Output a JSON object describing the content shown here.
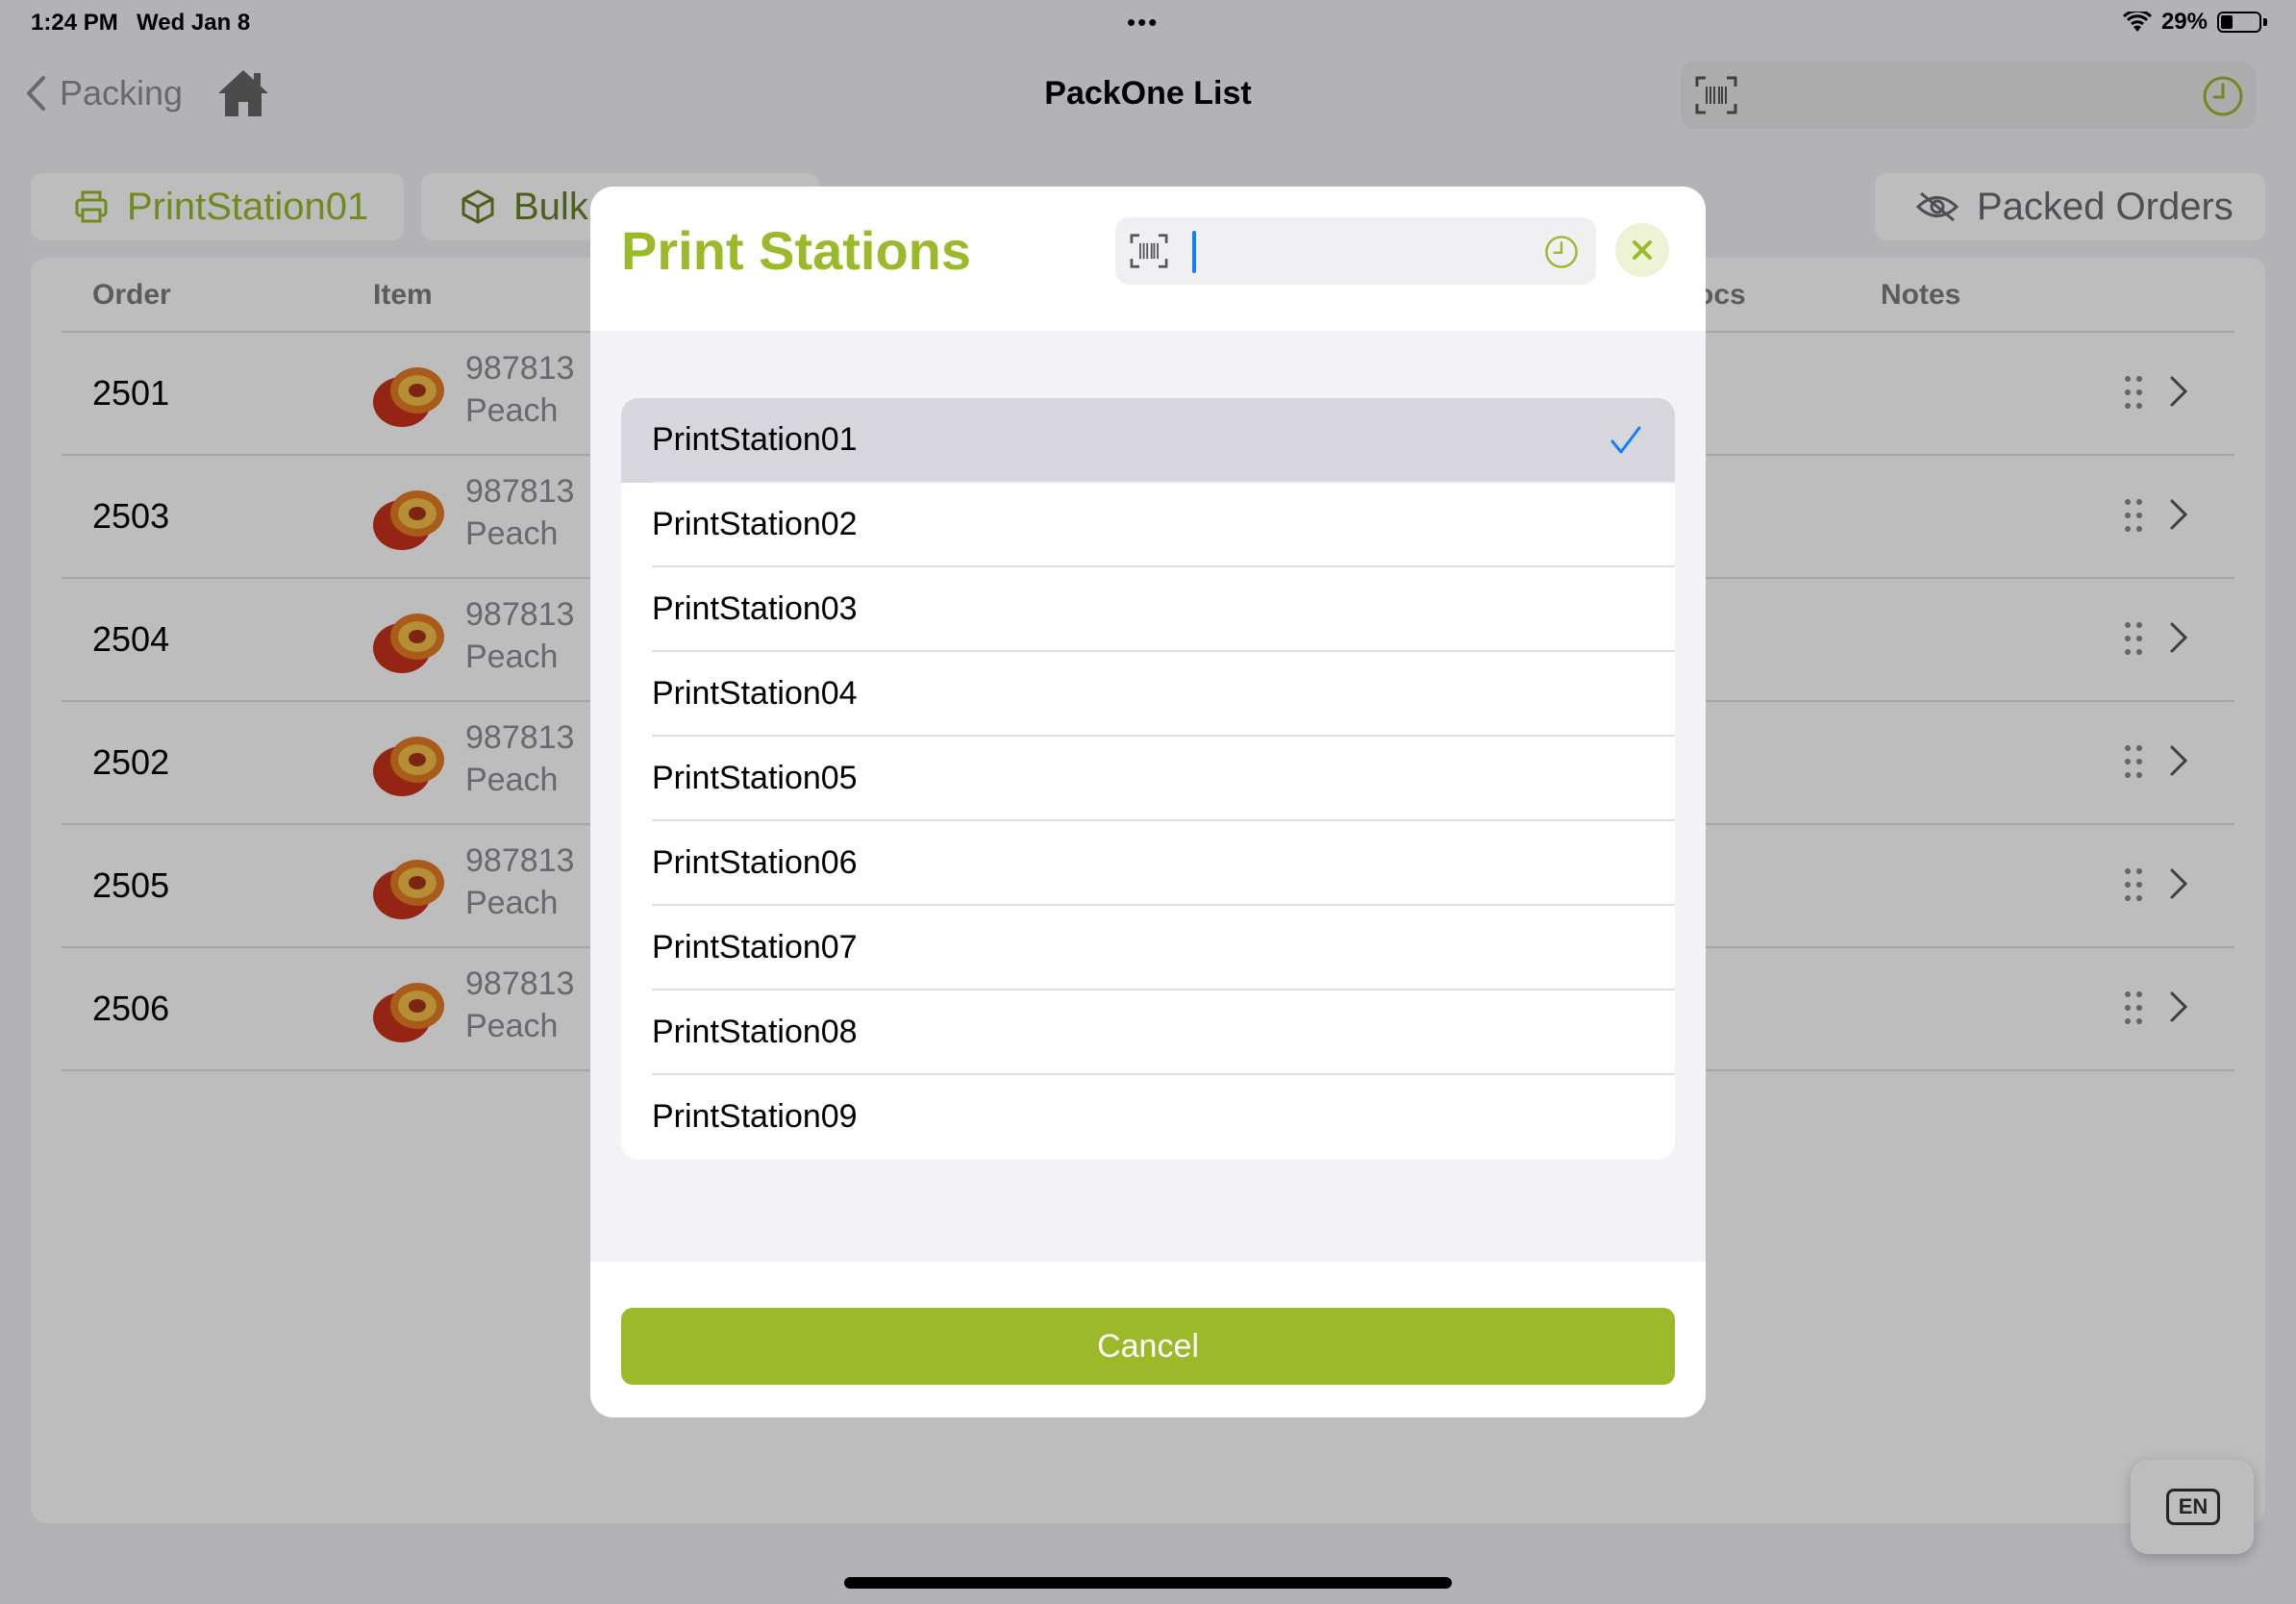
{
  "status_bar": {
    "time": "1:24 PM",
    "date": "Wed Jan 8",
    "battery": "29%"
  },
  "nav": {
    "back_label": "Packing",
    "title": "PackOne List"
  },
  "chips": {
    "print_station": "PrintStation01",
    "bulk": "Bulk",
    "packed_orders": "Packed Orders"
  },
  "table": {
    "headers": {
      "order": "Order",
      "item": "Item",
      "pcs": "ocs",
      "notes": "Notes"
    },
    "rows": [
      {
        "order": "2501",
        "sku": "987813",
        "name": "Peach"
      },
      {
        "order": "2503",
        "sku": "987813",
        "name": "Peach"
      },
      {
        "order": "2504",
        "sku": "987813",
        "name": "Peach"
      },
      {
        "order": "2502",
        "sku": "987813",
        "name": "Peach"
      },
      {
        "order": "2505",
        "sku": "987813",
        "name": "Peach"
      },
      {
        "order": "2506",
        "sku": "987813",
        "name": "Peach"
      }
    ]
  },
  "modal": {
    "title": "Print Stations",
    "search_value": "",
    "items": [
      {
        "label": "PrintStation01",
        "selected": true
      },
      {
        "label": "PrintStation02",
        "selected": false
      },
      {
        "label": "PrintStation03",
        "selected": false
      },
      {
        "label": "PrintStation04",
        "selected": false
      },
      {
        "label": "PrintStation05",
        "selected": false
      },
      {
        "label": "PrintStation06",
        "selected": false
      },
      {
        "label": "PrintStation07",
        "selected": false
      },
      {
        "label": "PrintStation08",
        "selected": false
      },
      {
        "label": "PrintStation09",
        "selected": false
      }
    ],
    "cancel_label": "Cancel"
  },
  "language_button": "EN",
  "colors": {
    "accent": "#9cb92a",
    "check": "#147efb",
    "selected_row": "#d6d6dc"
  }
}
